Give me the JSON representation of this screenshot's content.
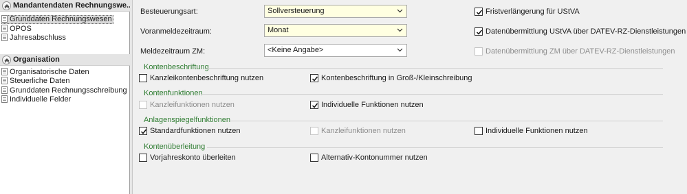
{
  "nav": {
    "sections": [
      {
        "title": "Mandantendaten Rechnungswe...",
        "items": [
          "Grunddaten Rechnungswesen",
          "OPOS",
          "Jahresabschluss"
        ]
      },
      {
        "title": "Organisation",
        "items": [
          "Organisatorische Daten",
          "Steuerliche Daten",
          "Grunddaten Rechnungsschreibung",
          "Individuelle Felder"
        ]
      }
    ],
    "selected_item": "Grunddaten Rechnungswesen"
  },
  "form": {
    "besteuerungsart": {
      "label": "Besteuerungsart:",
      "value": "Sollversteuerung"
    },
    "voranmeldezeitraum": {
      "label": "Voranmeldezeitraum:",
      "value": "Monat"
    },
    "meldezeitraum_zm": {
      "label": "Meldezeitraum ZM:",
      "value": "<Keine Angabe>"
    },
    "fristverlaengerung": {
      "label": "Fristverlängerung für UStVA",
      "checked": true,
      "enabled": true
    },
    "datenuebermittlung_ustva": {
      "label": "Datenübermittlung UStVA über DATEV-RZ-Dienstleistungen",
      "checked": true,
      "enabled": true
    },
    "datenuebermittlung_zm": {
      "label": "Datenübermittlung ZM über DATEV-RZ-Dienstleistungen",
      "checked": false,
      "enabled": false
    }
  },
  "groups": {
    "kontenbeschriftung": {
      "title": "Kontenbeschriftung",
      "kanzlei": {
        "label": "Kanzleikontenbeschriftung nutzen",
        "checked": false,
        "enabled": true
      },
      "gross_klein": {
        "label": "Kontenbeschriftung in Groß-/Kleinschreibung",
        "checked": true,
        "enabled": true
      }
    },
    "kontenfunktionen": {
      "title": "Kontenfunktionen",
      "kanzlei": {
        "label": "Kanzleifunktionen nutzen",
        "checked": false,
        "enabled": false
      },
      "individuell": {
        "label": "Individuelle Funktionen nutzen",
        "checked": true,
        "enabled": true
      }
    },
    "anlagenspiegel": {
      "title": "Anlagenspiegelfunktionen",
      "standard": {
        "label": "Standardfunktionen nutzen",
        "checked": true,
        "enabled": true
      },
      "kanzlei": {
        "label": "Kanzleifunktionen nutzen",
        "checked": false,
        "enabled": false
      },
      "individuell": {
        "label": "Individuelle Funktionen nutzen",
        "checked": false,
        "enabled": true
      }
    },
    "kontenueberleitung": {
      "title": "Kontenüberleitung",
      "vorjahr": {
        "label": "Vorjahreskonto überleiten",
        "checked": false,
        "enabled": true
      },
      "alternativ": {
        "label": "Alternativ-Kontonummer nutzen",
        "checked": false,
        "enabled": true
      }
    }
  },
  "colors": {
    "group_title": "#2f7d32",
    "combo_highlight": "#ffffe1"
  }
}
